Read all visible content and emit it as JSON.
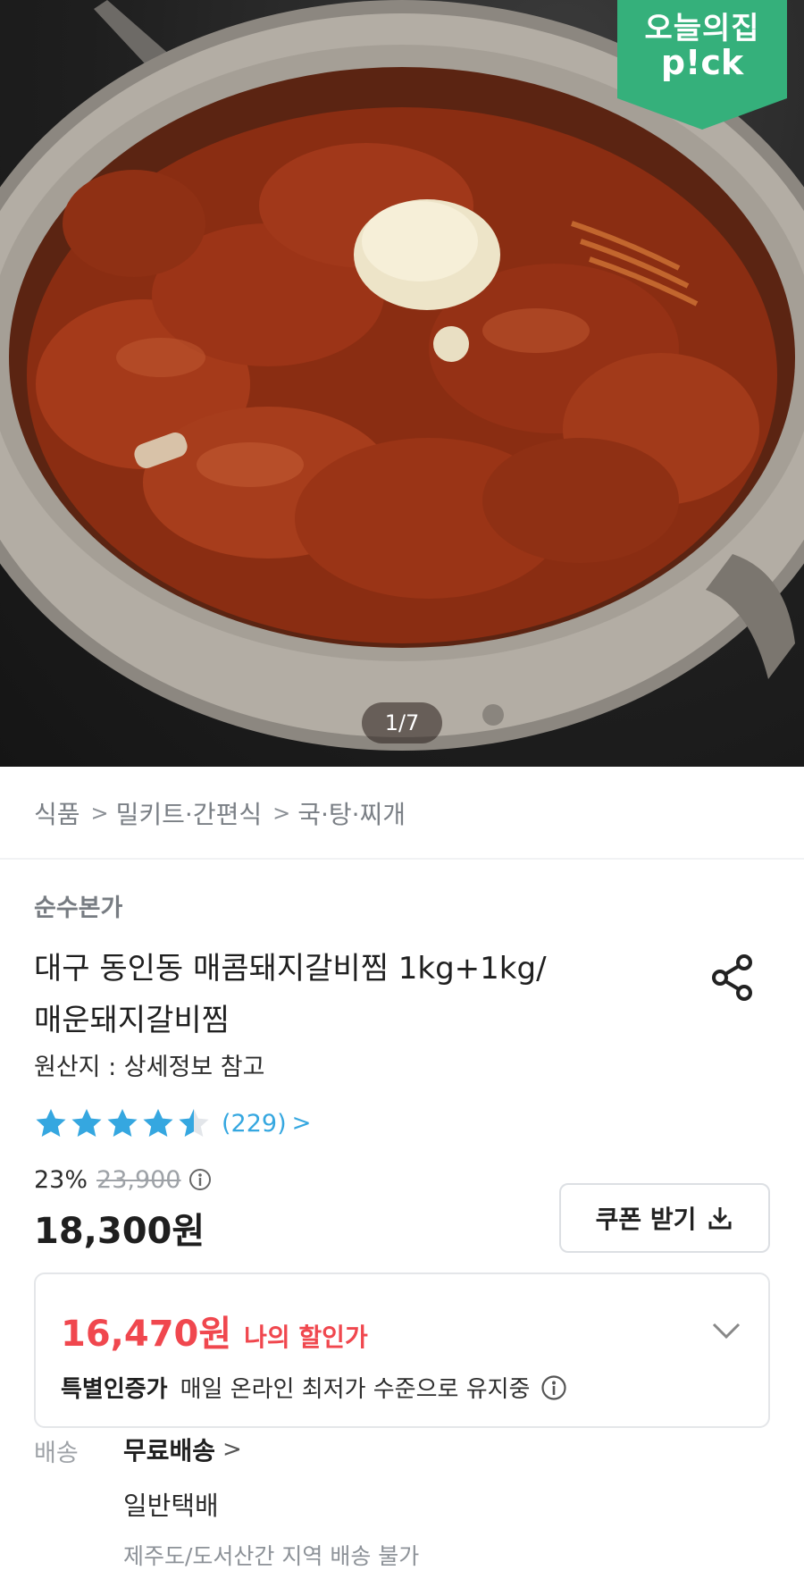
{
  "hero": {
    "badge_line1": "오늘의집",
    "badge_line2": "p!ck",
    "page_counter": "1/7",
    "badge_color": "#35b07b"
  },
  "breadcrumb": {
    "items": [
      "식품",
      "밀키트·간편식",
      "국·탕·찌개"
    ]
  },
  "product": {
    "brand": "순수본가",
    "title_line1": "대구 동인동 매콤돼지갈비찜 1kg+1kg/",
    "title_line2": "매운돼지갈비찜",
    "origin": "원산지 : 상세정보 참고",
    "rating": 4.5,
    "rating_max": 5,
    "review_count": "(229)",
    "discount_rate": "23%",
    "original_price": "23,900",
    "price": "18,300원",
    "star_color": "#35a7e0",
    "price_accent_color": "#f0474e"
  },
  "coupon": {
    "label": "쿠폰 받기"
  },
  "my_price": {
    "price": "16,470원",
    "label": "나의 할인가",
    "cert_badge": "특별인증가",
    "cert_desc": "매일 온라인 최저가 수준으로 유지중"
  },
  "delivery": {
    "label": "배송",
    "free": "무료배송",
    "type": "일반택배",
    "note": "제주도/도서산간 지역 배송 불가"
  }
}
